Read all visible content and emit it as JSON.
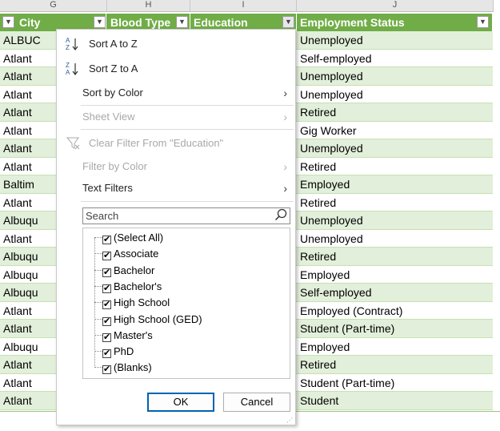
{
  "column_letters": [
    "G",
    "H",
    "I",
    "J"
  ],
  "headers": {
    "city": "City",
    "blood_type": "Blood Type",
    "education": "Education",
    "employment_status": "Employment Status"
  },
  "colors": {
    "header_green": "#70ad47",
    "band_green": "#e2efda",
    "accent_blue": "#0063b1"
  },
  "rows": [
    {
      "city": "ALBUC",
      "status": "Unemployed"
    },
    {
      "city": "Atlant",
      "status": "Self-employed"
    },
    {
      "city": "Atlant",
      "status": "Unemployed"
    },
    {
      "city": "Atlant",
      "status": "Unemployed"
    },
    {
      "city": "Atlant",
      "status": "Retired"
    },
    {
      "city": "Atlant",
      "status": "Gig Worker"
    },
    {
      "city": "Atlant",
      "status": "Unemployed"
    },
    {
      "city": "Atlant",
      "status": "Retired"
    },
    {
      "city": "Baltim",
      "status": "Employed"
    },
    {
      "city": "Atlant",
      "status": "Retired"
    },
    {
      "city": "Albuqu",
      "status": "Unemployed"
    },
    {
      "city": "Atlant",
      "status": "Unemployed"
    },
    {
      "city": "Albuqu",
      "status": "Retired"
    },
    {
      "city": "Albuqu",
      "status": "Employed"
    },
    {
      "city": "Albuqu",
      "status": "Self-employed"
    },
    {
      "city": "Atlant",
      "status": "Employed (Contract)"
    },
    {
      "city": "Atlant",
      "status": "Student (Part-time)"
    },
    {
      "city": "Albuqu",
      "status": "Employed"
    },
    {
      "city": "Atlant",
      "status": "Retired"
    },
    {
      "city": "Atlant",
      "status": "Student (Part-time)"
    },
    {
      "city": "Atlant",
      "status": "Student"
    }
  ],
  "menu": {
    "sort_a_z": "Sort A to Z",
    "sort_z_a": "Sort Z to A",
    "sort_by_color": "Sort by Color",
    "sheet_view": "Sheet View",
    "clear_filter": "Clear Filter From \"Education\"",
    "filter_by_color": "Filter by Color",
    "text_filters": "Text Filters",
    "search_placeholder": "Search",
    "ok": "OK",
    "cancel": "Cancel"
  },
  "filter_items": [
    {
      "label": "(Select All)",
      "checked": true
    },
    {
      "label": "Associate",
      "checked": true
    },
    {
      "label": "Bachelor",
      "checked": true
    },
    {
      "label": "Bachelor's",
      "checked": true
    },
    {
      "label": "High School",
      "checked": true
    },
    {
      "label": "High School (GED)",
      "checked": true
    },
    {
      "label": "Master's",
      "checked": true
    },
    {
      "label": "PhD",
      "checked": true
    },
    {
      "label": "(Blanks)",
      "checked": true
    }
  ]
}
